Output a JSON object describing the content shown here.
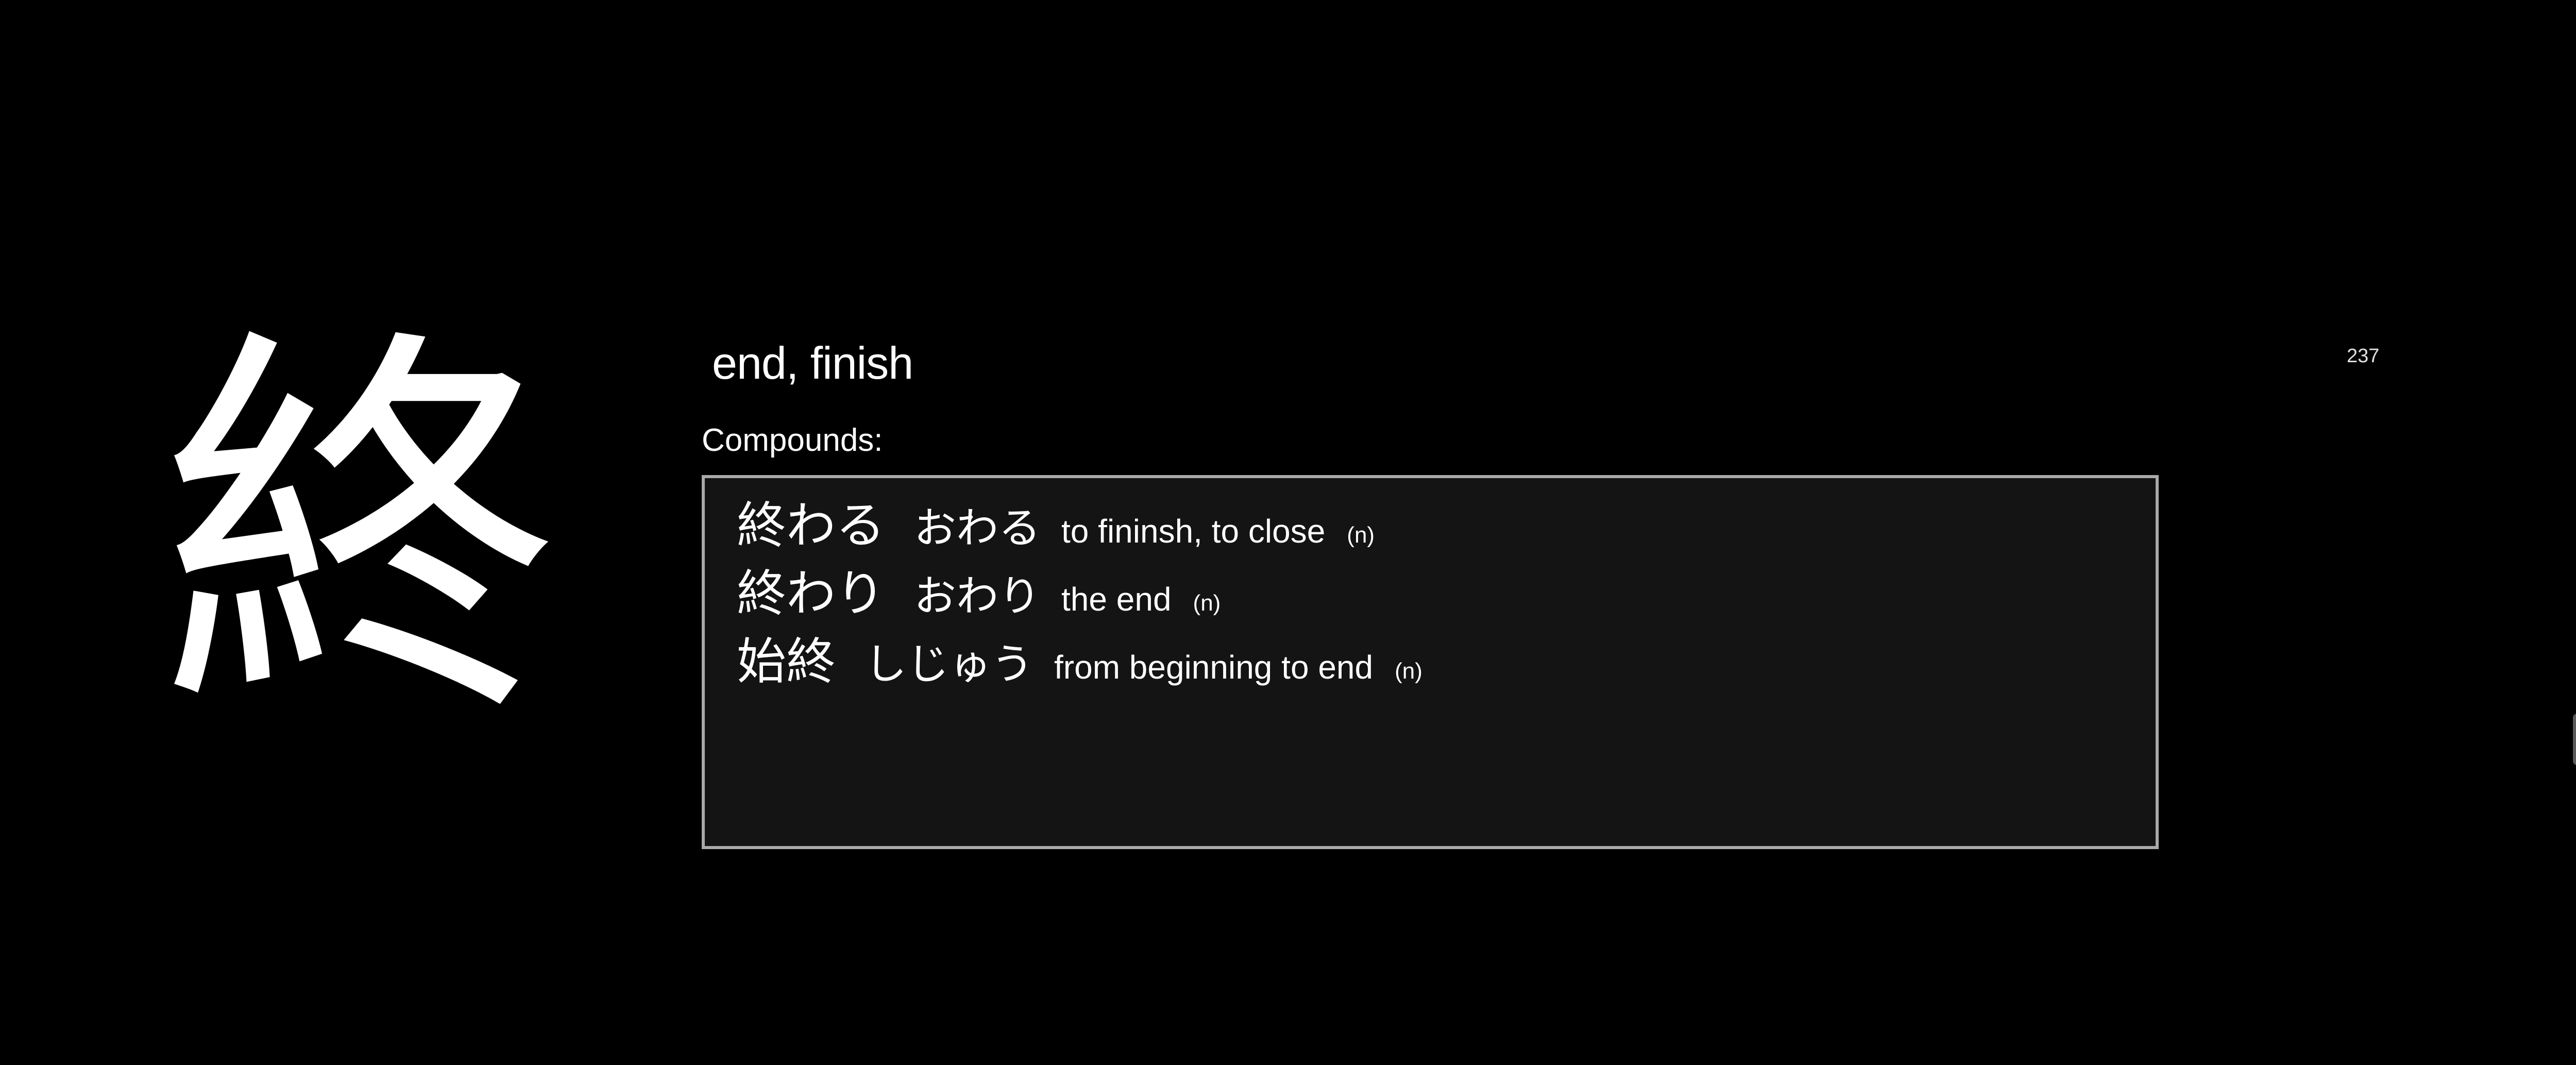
{
  "card": {
    "kanji": "終",
    "meaning": "end, finish",
    "number": "237",
    "compounds_label": "Compounds:",
    "compounds": [
      {
        "word": "終わる",
        "reading": "おわる",
        "definition": "to fininsh, to close",
        "type": "(n)"
      },
      {
        "word": "終わり",
        "reading": "おわり",
        "definition": "the end",
        "type": "(n)"
      },
      {
        "word": "始終",
        "reading": "しじゅう",
        "definition": "from beginning to end",
        "type": "(n)"
      }
    ]
  },
  "colors": {
    "background": "#000000",
    "text": "#ffffff",
    "box_background": "#141414",
    "box_border": "#a9a9a9"
  }
}
